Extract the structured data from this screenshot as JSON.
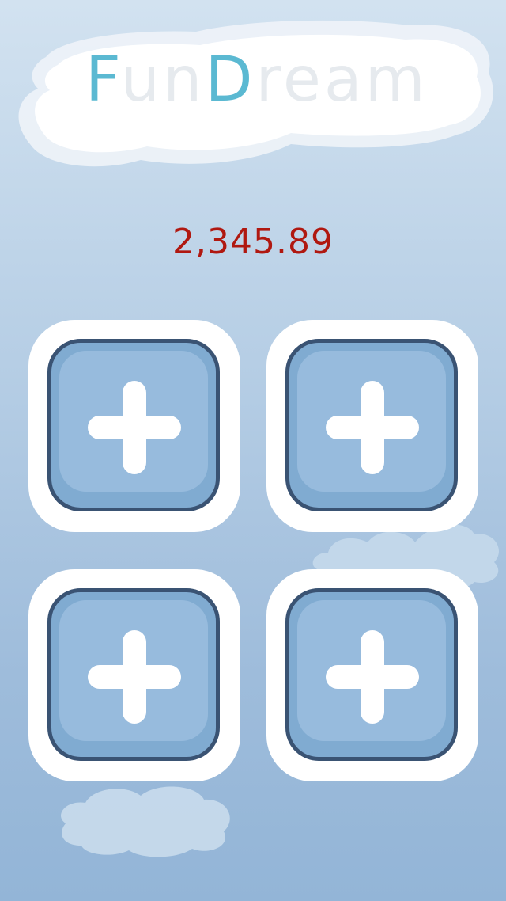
{
  "app": {
    "logo_parts": [
      "F",
      "un",
      "D",
      "ream"
    ],
    "logo_text": "FunDream"
  },
  "balance": "2,345.89",
  "slots": [
    {
      "icon": "plus-icon"
    },
    {
      "icon": "plus-icon"
    },
    {
      "icon": "plus-icon"
    },
    {
      "icon": "plus-icon"
    }
  ],
  "colors": {
    "logo_accent": "#5bb9d2",
    "balance": "#b01810",
    "button_border": "#3a5373",
    "button_fill": "#97bbdd"
  }
}
